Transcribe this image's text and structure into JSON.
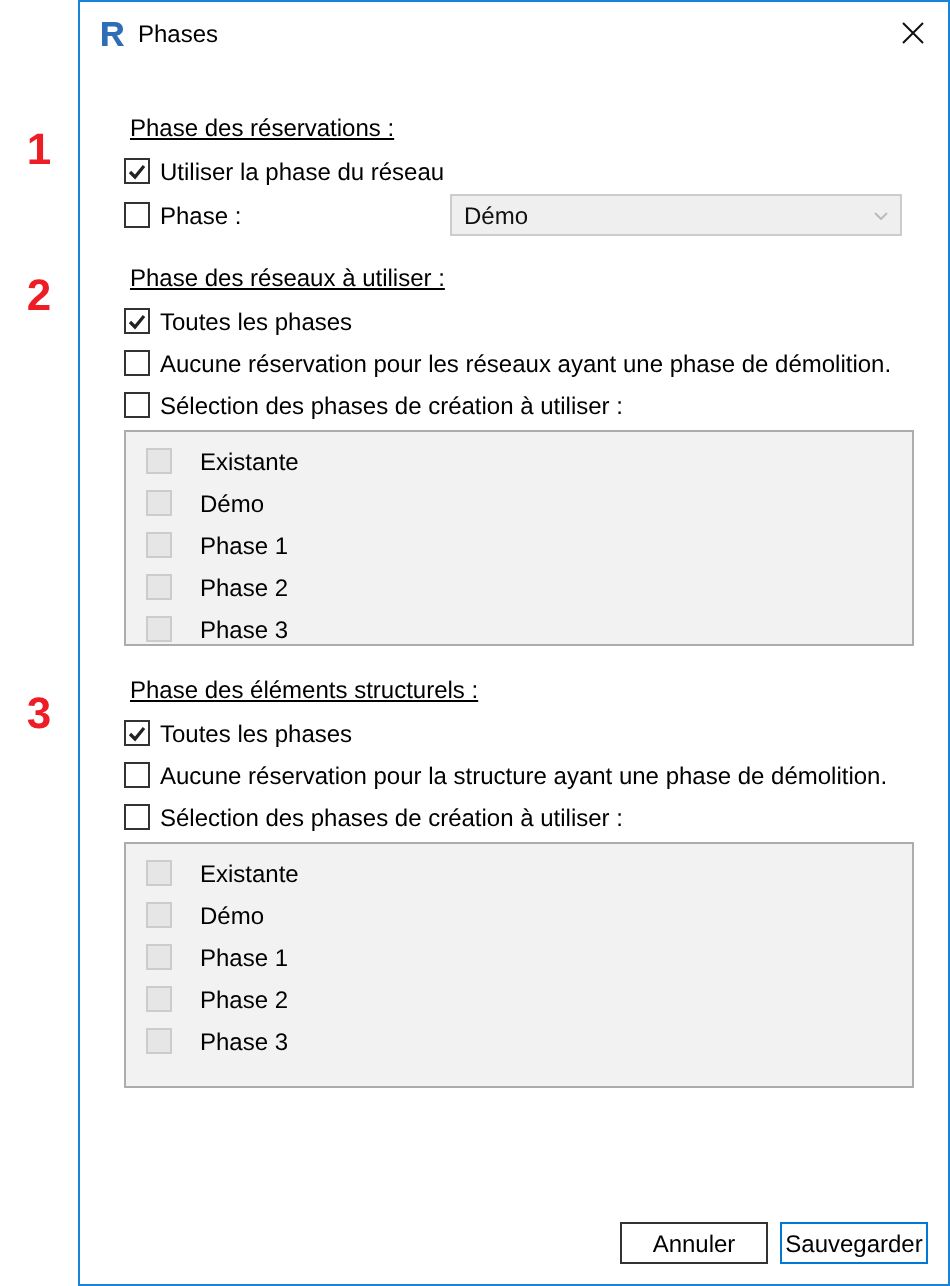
{
  "window": {
    "title": "Phases"
  },
  "sections": [
    {
      "marker": "1",
      "title": "Phase des réservations :",
      "options": [
        {
          "kind": "checkbox",
          "label": "Utiliser la phase du réseau",
          "checked": true
        },
        {
          "kind": "checkbox-dropdown",
          "label": "Phase :",
          "checked": false,
          "value": "Démo",
          "disabled": true
        }
      ]
    },
    {
      "marker": "2",
      "title": "Phase des réseaux à utiliser :",
      "options": [
        {
          "kind": "checkbox",
          "label": "Toutes les phases",
          "checked": true
        },
        {
          "kind": "checkbox",
          "label": "Aucune réservation pour les réseaux ayant une phase de démolition.",
          "checked": false
        },
        {
          "kind": "checkbox",
          "label": "Sélection des phases de création à utiliser :",
          "checked": false
        }
      ],
      "list": {
        "disabled": true,
        "items": [
          {
            "label": "Existante",
            "checked": false
          },
          {
            "label": "Démo",
            "checked": false
          },
          {
            "label": "Phase 1",
            "checked": false
          },
          {
            "label": "Phase 2",
            "checked": false
          },
          {
            "label": "Phase 3",
            "checked": false
          }
        ]
      }
    },
    {
      "marker": "3",
      "title": "Phase des éléments structurels  :",
      "options": [
        {
          "kind": "checkbox",
          "label": "Toutes les phases",
          "checked": true
        },
        {
          "kind": "checkbox",
          "label": "Aucune réservation pour la structure ayant une phase de démolition.",
          "checked": false
        },
        {
          "kind": "checkbox",
          "label": "Sélection des phases de création à utiliser :",
          "checked": false
        }
      ],
      "list": {
        "disabled": true,
        "items": [
          {
            "label": "Existante",
            "checked": false
          },
          {
            "label": "Démo",
            "checked": false
          },
          {
            "label": "Phase 1",
            "checked": false
          },
          {
            "label": "Phase 2",
            "checked": false
          },
          {
            "label": "Phase 3",
            "checked": false
          }
        ]
      }
    }
  ],
  "buttons": [
    {
      "label": "Annuler",
      "default": false
    },
    {
      "label": "Sauvegarder",
      "default": true
    }
  ]
}
